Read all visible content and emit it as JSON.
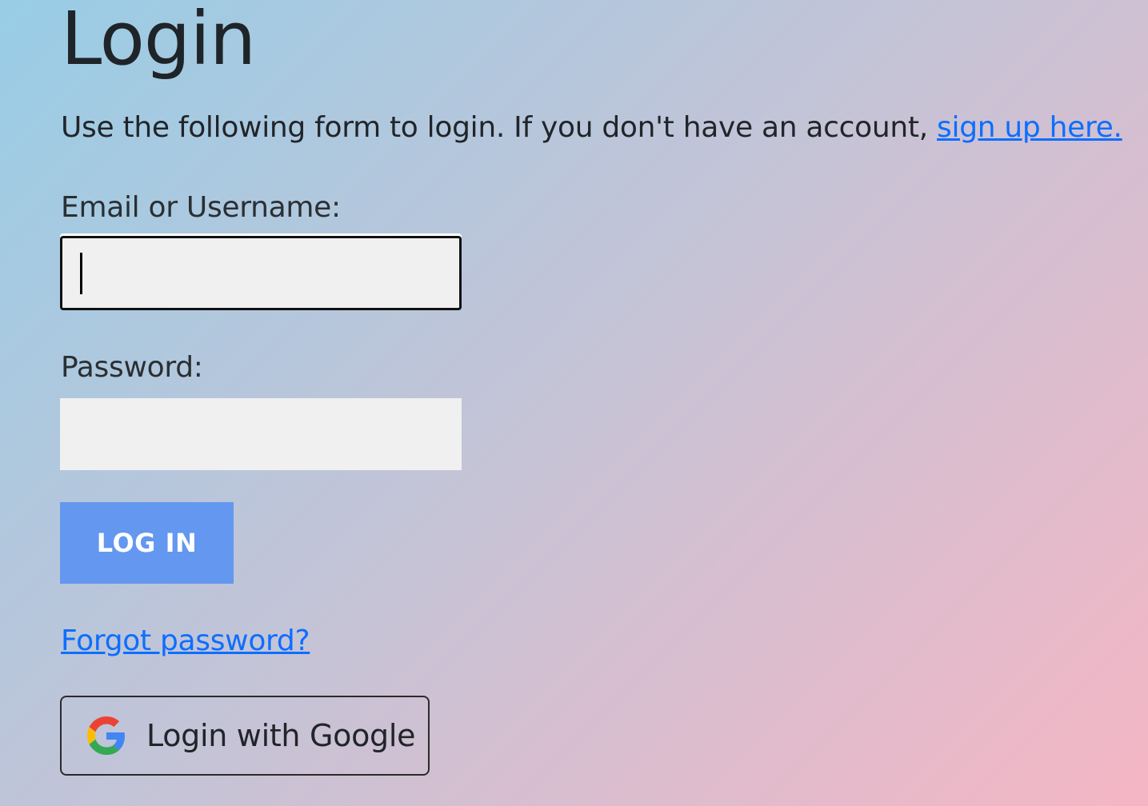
{
  "page": {
    "title": "Login",
    "intro_text": "Use the following form to login. If you don't have an account, ",
    "signup_link": "sign up here."
  },
  "form": {
    "email_label": "Email or Username:",
    "email_value": "",
    "password_label": "Password:",
    "password_value": "",
    "submit_label": "LOG IN",
    "forgot_link": "Forgot password?",
    "google_button_label": "Login with Google"
  },
  "colors": {
    "accent_button": "#6497ef",
    "link": "#0d6efd",
    "gradient_start": "#98cde6",
    "gradient_end": "#f5b6c4"
  },
  "icons": {
    "google": "google-g-icon"
  }
}
